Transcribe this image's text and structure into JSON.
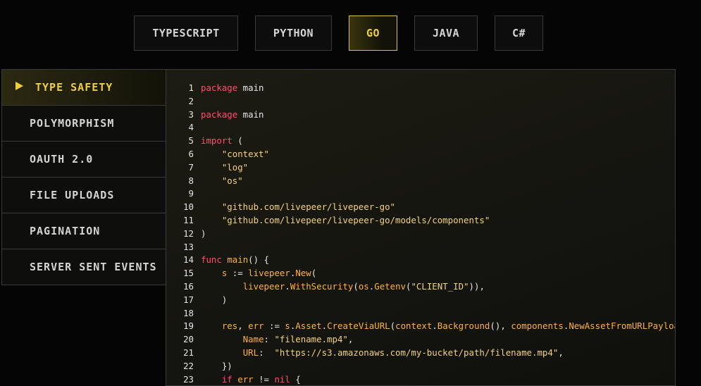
{
  "tabs": [
    {
      "label": "TYPESCRIPT",
      "active": false
    },
    {
      "label": "PYTHON",
      "active": false
    },
    {
      "label": "GO",
      "active": true
    },
    {
      "label": "JAVA",
      "active": false
    },
    {
      "label": "C#",
      "active": false
    }
  ],
  "sidebar": {
    "items": [
      {
        "label": "TYPE SAFETY",
        "active": true
      },
      {
        "label": "POLYMORPHISM",
        "active": false
      },
      {
        "label": "OAUTH 2.0",
        "active": false
      },
      {
        "label": "FILE UPLOADS",
        "active": false
      },
      {
        "label": "PAGINATION",
        "active": false
      },
      {
        "label": "SERVER SENT EVENTS",
        "active": false
      }
    ]
  },
  "code": {
    "lines": [
      {
        "n": "1",
        "tokens": [
          [
            "kw",
            "package"
          ],
          [
            "pl",
            " main"
          ]
        ]
      },
      {
        "n": "2",
        "tokens": []
      },
      {
        "n": "3",
        "tokens": [
          [
            "kw",
            "package"
          ],
          [
            "pl",
            " main"
          ]
        ]
      },
      {
        "n": "4",
        "tokens": []
      },
      {
        "n": "5",
        "tokens": [
          [
            "kw",
            "import"
          ],
          [
            "pl",
            " ("
          ]
        ]
      },
      {
        "n": "6",
        "tokens": [
          [
            "pl",
            "    "
          ],
          [
            "str",
            "\"context\""
          ]
        ]
      },
      {
        "n": "7",
        "tokens": [
          [
            "pl",
            "    "
          ],
          [
            "str",
            "\"log\""
          ]
        ]
      },
      {
        "n": "8",
        "tokens": [
          [
            "pl",
            "    "
          ],
          [
            "str",
            "\"os\""
          ]
        ]
      },
      {
        "n": "9",
        "tokens": []
      },
      {
        "n": "10",
        "tokens": [
          [
            "pl",
            "    "
          ],
          [
            "str",
            "\"github.com/livepeer/livepeer-go\""
          ]
        ]
      },
      {
        "n": "11",
        "tokens": [
          [
            "pl",
            "    "
          ],
          [
            "str",
            "\"github.com/livepeer/livepeer-go/models/components\""
          ]
        ]
      },
      {
        "n": "12",
        "tokens": [
          [
            "pl",
            ")"
          ]
        ]
      },
      {
        "n": "13",
        "tokens": []
      },
      {
        "n": "14",
        "tokens": [
          [
            "kw",
            "func"
          ],
          [
            "pl",
            " "
          ],
          [
            "fn",
            "main"
          ],
          [
            "pl",
            "() {"
          ]
        ]
      },
      {
        "n": "15",
        "tokens": [
          [
            "pl",
            "    "
          ],
          [
            "fn",
            "s"
          ],
          [
            "pl",
            " := "
          ],
          [
            "fn",
            "livepeer"
          ],
          [
            "pl",
            "."
          ],
          [
            "fn",
            "New"
          ],
          [
            "pl",
            "("
          ]
        ]
      },
      {
        "n": "16",
        "tokens": [
          [
            "pl",
            "        "
          ],
          [
            "fn",
            "livepeer"
          ],
          [
            "pl",
            "."
          ],
          [
            "fn",
            "WithSecurity"
          ],
          [
            "pl",
            "("
          ],
          [
            "fn",
            "os"
          ],
          [
            "pl",
            "."
          ],
          [
            "fn",
            "Getenv"
          ],
          [
            "pl",
            "("
          ],
          [
            "str",
            "\"CLIENT_ID\""
          ],
          [
            "pl",
            ")),"
          ]
        ]
      },
      {
        "n": "17",
        "tokens": [
          [
            "pl",
            "    )"
          ]
        ]
      },
      {
        "n": "18",
        "tokens": []
      },
      {
        "n": "19",
        "tokens": [
          [
            "pl",
            "    "
          ],
          [
            "fn",
            "res"
          ],
          [
            "pl",
            ", "
          ],
          [
            "fn",
            "err"
          ],
          [
            "pl",
            " := "
          ],
          [
            "fn",
            "s"
          ],
          [
            "pl",
            "."
          ],
          [
            "fn",
            "Asset"
          ],
          [
            "pl",
            "."
          ],
          [
            "fn",
            "CreateViaURL"
          ],
          [
            "pl",
            "("
          ],
          [
            "fn",
            "context"
          ],
          [
            "pl",
            "."
          ],
          [
            "fn",
            "Background"
          ],
          [
            "pl",
            "(), "
          ],
          [
            "fn",
            "components"
          ],
          [
            "pl",
            "."
          ],
          [
            "fn",
            "NewAssetFromURLPayload"
          ]
        ]
      },
      {
        "n": "20",
        "tokens": [
          [
            "pl",
            "        "
          ],
          [
            "fn",
            "Name"
          ],
          [
            "pl",
            ": "
          ],
          [
            "str",
            "\"filename.mp4\""
          ],
          [
            "pl",
            ","
          ]
        ]
      },
      {
        "n": "21",
        "tokens": [
          [
            "pl",
            "        "
          ],
          [
            "fn",
            "URL"
          ],
          [
            "pl",
            ":  "
          ],
          [
            "str",
            "\"https://s3.amazonaws.com/my-bucket/path/filename.mp4\""
          ],
          [
            "pl",
            ","
          ]
        ]
      },
      {
        "n": "22",
        "tokens": [
          [
            "pl",
            "    })"
          ]
        ]
      },
      {
        "n": "23",
        "tokens": [
          [
            "pl",
            "    "
          ],
          [
            "kw",
            "if"
          ],
          [
            "pl",
            " "
          ],
          [
            "fn",
            "err"
          ],
          [
            "pl",
            " != "
          ],
          [
            "kw",
            "nil"
          ],
          [
            "pl",
            " {"
          ]
        ]
      }
    ]
  }
}
